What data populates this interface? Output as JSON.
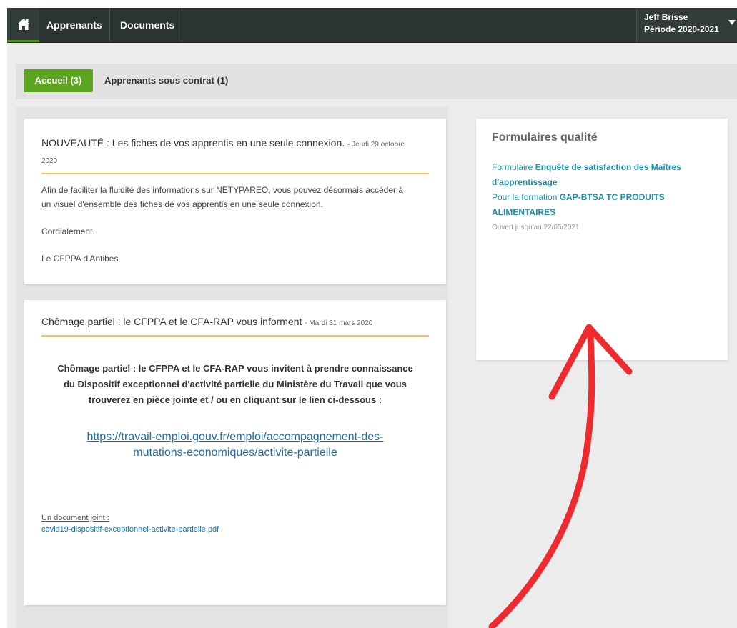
{
  "nav": {
    "items": [
      "Apprenants",
      "Documents"
    ],
    "user_name": "Jeff Brisse",
    "period": "Période 2020-2021"
  },
  "tabs": {
    "active": "Accueil (3)",
    "other": "Apprenants sous contrat (1)"
  },
  "news1": {
    "title": "NOUVEAUTÉ : Les fiches de vos apprentis en une seule connexion.",
    "date_line1": "- Jeudi 29 octobre",
    "date_line2": "2020",
    "body_line1": "Afin de faciliter la fluidité des informations sur NETYPAREO, vous pouvez désormais accéder à",
    "body_line2": "un visuel d'ensemble des fiches de vos apprentis en une seule connexion.",
    "closing": "Cordialement.",
    "signature": "Le CFPPA d'Antibes"
  },
  "news2": {
    "title": "Chômage partiel : le CFPPA et le CFA-RAP vous informent",
    "date": "- Mardi 31 mars 2020",
    "body_line1": "Chômage partiel : le CFPPA et le CFA-RAP vous invitent à prendre connaissance",
    "body_line2": "du Dispositif exceptionnel d'activité partielle du Ministère du Travail que vous",
    "body_line3": "trouverez en pièce jointe et / ou en cliquant sur le lien ci-dessous :",
    "link_line1": "https://travail-emploi.gouv.fr/emploi/accompagnement-des-",
    "link_line2": "mutations-economiques/activite-partielle",
    "attachment_label": "Un document joint :",
    "attachment_file": "covid19-dispositif-exceptionnel-activite-partielle.pdf"
  },
  "forms": {
    "title": "Formulaires qualité",
    "prefix1": "Formulaire ",
    "form_name_line1": "Enquête de satisfaction des Maîtres",
    "form_name_line2": "d'apprentissage",
    "prefix2": "Pour la formation ",
    "formation_line1": "GAP-BTSA TC PRODUITS",
    "formation_line2": "ALIMENTAIRES",
    "open_until": "Ouvert jusqu'au 22/05/2021"
  },
  "colors": {
    "topbar": "#2b3433",
    "accent_green": "#5aa51d",
    "divider_orange": "#f7c25a",
    "link_teal": "#1e8fa8",
    "annotation_arrow": "#ee2a2f"
  },
  "icons": {
    "home": "home-icon",
    "caret": "caret-down-icon",
    "annotation": "red-arrow-annotation"
  }
}
